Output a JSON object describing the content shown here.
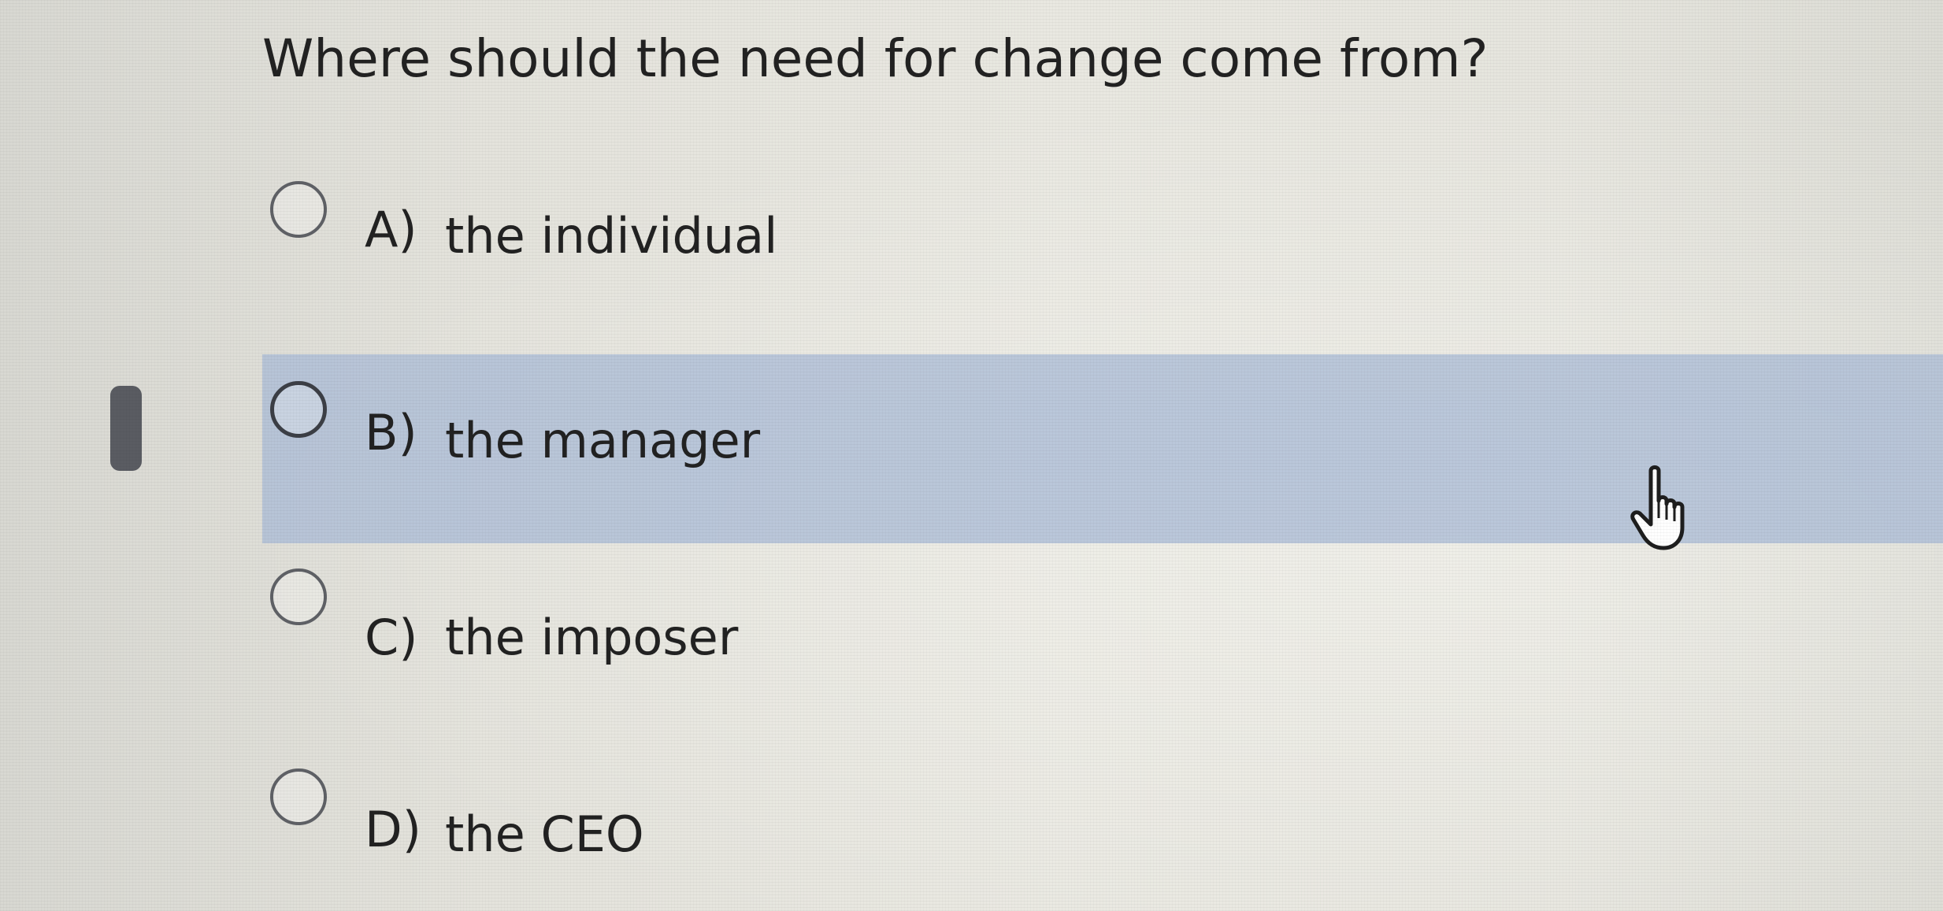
{
  "question": {
    "text": "Where should the need for change come from?"
  },
  "options": [
    {
      "letter": "A)",
      "text": "the individual",
      "selected": false,
      "highlighted": false
    },
    {
      "letter": "B)",
      "text": "the manager",
      "selected": false,
      "highlighted": true
    },
    {
      "letter": "C)",
      "text": "the imposer",
      "selected": false,
      "highlighted": false
    },
    {
      "letter": "D)",
      "text": "the CEO",
      "selected": false,
      "highlighted": false
    }
  ],
  "colors": {
    "highlight_row": "#acbcd6",
    "radio_border": "#5f6166",
    "text": "#222222",
    "background": "#e6e5de"
  },
  "icons": {
    "cursor": "hand-pointer-icon",
    "focus_marker": "focus-indicator"
  }
}
